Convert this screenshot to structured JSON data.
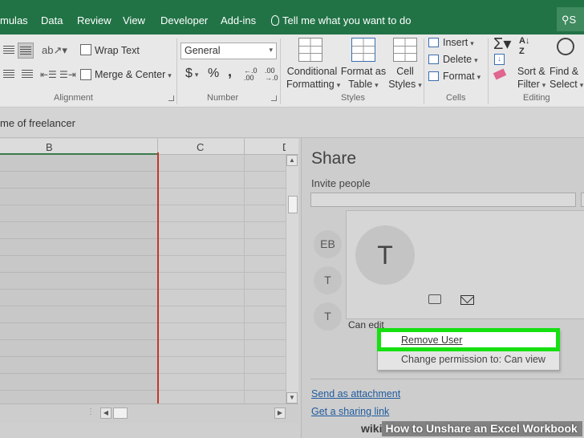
{
  "ribbon_tabs": [
    "mulas",
    "Data",
    "Review",
    "View",
    "Developer",
    "Add-ins"
  ],
  "tell_me": "Tell me what you want to do",
  "user_badge": "S",
  "groups": {
    "alignment": {
      "label": "Alignment",
      "wrap_text": "Wrap Text",
      "merge_center": "Merge & Center"
    },
    "number": {
      "label": "Number",
      "format_value": "General",
      "currency": "$",
      "percent": "%",
      "comma": ",",
      "inc_decimal": "←.0 .00",
      "dec_decimal": ".00 →.0"
    },
    "styles": {
      "label": "Styles",
      "conditional_formatting": [
        "Conditional",
        "Formatting"
      ],
      "format_as_table": [
        "Format as",
        "Table"
      ],
      "cell_styles": [
        "Cell",
        "Styles"
      ]
    },
    "cells": {
      "label": "Cells",
      "insert": "Insert",
      "delete": "Delete",
      "format": "Format"
    },
    "editing": {
      "label": "Editing",
      "sort_filter": [
        "Sort &",
        "Filter"
      ],
      "find_select": [
        "Find &",
        "Select"
      ]
    }
  },
  "formula_bar_text": "me of freelancer",
  "columns": [
    "B",
    "C",
    "D"
  ],
  "share_pane": {
    "title": "Share",
    "invite_label": "Invite people",
    "selected_avatar": "T",
    "avatars": [
      "EB",
      "T",
      "T"
    ],
    "permission": "Can edit",
    "context_menu": {
      "remove_user": "Remove User",
      "change_permission": "Change permission to: Can view"
    },
    "send_attachment": "Send as attachment",
    "get_link": "Get a sharing link"
  },
  "watermark": {
    "brand": "wiki",
    "title": "How to Unshare an Excel Workbook"
  },
  "colors": {
    "ribbon_green": "#217346",
    "highlight": "#16e012",
    "link": "#1f5b9e"
  }
}
